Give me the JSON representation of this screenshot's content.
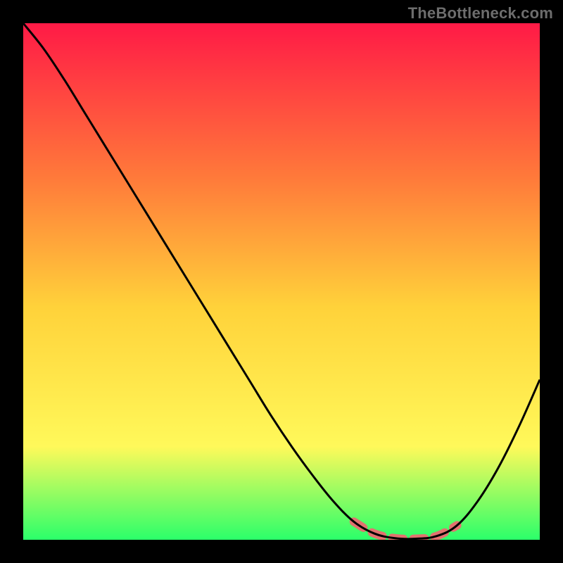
{
  "watermark": "TheBottleneck.com",
  "colors": {
    "frame": "#000000",
    "gradient_top": "#ff1a46",
    "gradient_mid_upper": "#ff7a3a",
    "gradient_mid": "#ffd23a",
    "gradient_mid_lower": "#fff95a",
    "gradient_bottom": "#2bff6a",
    "curve": "#000000",
    "highlight": "#e2716f"
  },
  "chart_data": {
    "type": "line",
    "title": "",
    "xlabel": "",
    "ylabel": "",
    "xlim": [
      0,
      100
    ],
    "ylim": [
      0,
      100
    ],
    "grid": false,
    "series": [
      {
        "name": "bottleneck-curve",
        "x": [
          0,
          4,
          8,
          12,
          16,
          20,
          24,
          28,
          32,
          36,
          40,
          44,
          48,
          52,
          56,
          60,
          64,
          68,
          72,
          76,
          80,
          84,
          88,
          92,
          96,
          100
        ],
        "y": [
          100,
          95,
          89,
          82.5,
          76,
          69.5,
          63,
          56.5,
          50,
          43.5,
          37,
          30.5,
          24,
          18,
          12.5,
          7.5,
          3.5,
          1.2,
          0.3,
          0.2,
          0.7,
          2.8,
          7.5,
          14,
          22,
          31
        ]
      }
    ],
    "highlight_range": {
      "x_start": 64,
      "x_end": 84
    },
    "legend": false
  }
}
